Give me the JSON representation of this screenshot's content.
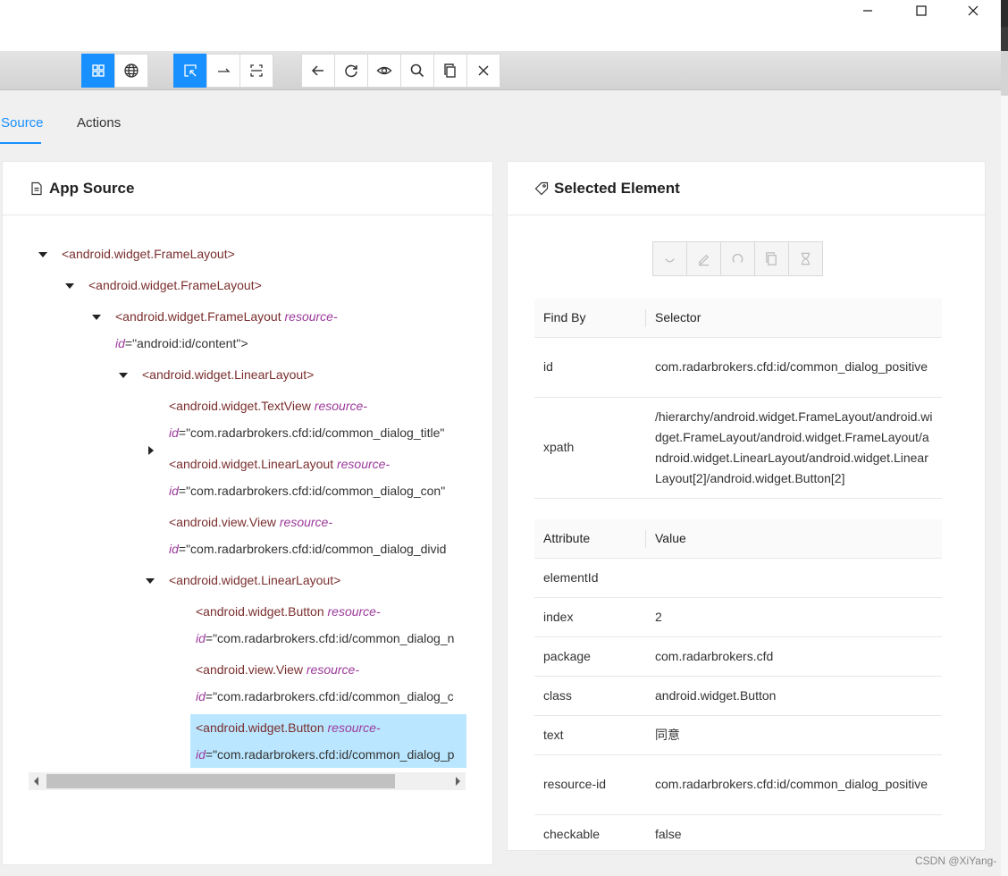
{
  "window": {
    "controls": [
      "minimize-icon",
      "maximize-icon",
      "close-icon"
    ]
  },
  "toolbar": {
    "group1": [
      {
        "icon": "grid-icon",
        "active": true
      },
      {
        "icon": "globe-icon",
        "active": false
      }
    ],
    "group2": [
      {
        "icon": "select-element-icon",
        "active": true
      },
      {
        "icon": "swipe-icon",
        "active": false
      },
      {
        "icon": "tap-coordinates-icon",
        "active": false
      }
    ],
    "group3": [
      {
        "icon": "back-icon"
      },
      {
        "icon": "refresh-icon"
      },
      {
        "icon": "eye-icon"
      },
      {
        "icon": "search-icon"
      },
      {
        "icon": "copy-icon"
      },
      {
        "icon": "close-session-icon"
      }
    ]
  },
  "tabs": {
    "source": "Source",
    "actions": "Actions"
  },
  "app_source": {
    "title": "App Source",
    "nodes": [
      {
        "tag": "<android.widget.FrameLayout>"
      },
      {
        "tag": "<android.widget.FrameLayout>"
      },
      {
        "tag": "<android.widget.FrameLayout",
        "attr": "resource-",
        "attr2": "id",
        "val": "=\"android:id/content\">"
      },
      {
        "tag": "<android.widget.LinearLayout>"
      },
      {
        "tag": "<android.widget.TextView",
        "attr": "resource-",
        "attr2": "id",
        "val": "=\"com.radarbrokers.cfd:id/common_dialog_title\""
      },
      {
        "tag": "<android.widget.LinearLayout",
        "attr": "resource-",
        "attr2": "id",
        "val": "=\"com.radarbrokers.cfd:id/common_dialog_con\""
      },
      {
        "tag": "<android.view.View",
        "attr": "resource-",
        "attr2": "id",
        "val": "=\"com.radarbrokers.cfd:id/common_dialog_divid"
      },
      {
        "tag": "<android.widget.LinearLayout>"
      },
      {
        "tag": "<android.widget.Button",
        "attr": "resource-",
        "attr2": "id",
        "val": "=\"com.radarbrokers.cfd:id/common_dialog_n"
      },
      {
        "tag": "<android.view.View",
        "attr": "resource-",
        "attr2": "id",
        "val": "=\"com.radarbrokers.cfd:id/common_dialog_c"
      },
      {
        "tag": "<android.widget.Button",
        "attr": "resource-",
        "attr2": "id",
        "val": "=\"com.radarbrokers.cfd:id/common_dialog_p"
      }
    ]
  },
  "selected_element": {
    "title": "Selected Element",
    "actions": [
      "tap-icon",
      "edit-icon",
      "clear-icon",
      "copy-icon",
      "timing-icon"
    ],
    "find_by": {
      "headers": [
        "Find By",
        "Selector"
      ],
      "rows": [
        [
          "id",
          "com.radarbrokers.cfd:id/common_dialog_positive"
        ],
        [
          "xpath",
          "/hierarchy/android.widget.FrameLayout/android.widget.FrameLayout/android.widget.FrameLayout/android.widget.LinearLayout/android.widget.LinearLayout[2]/android.widget.Button[2]"
        ]
      ]
    },
    "attributes": {
      "headers": [
        "Attribute",
        "Value"
      ],
      "rows": [
        [
          "elementId",
          ""
        ],
        [
          "index",
          "2"
        ],
        [
          "package",
          "com.radarbrokers.cfd"
        ],
        [
          "class",
          "android.widget.Button"
        ],
        [
          "text",
          "同意"
        ],
        [
          "resource-id",
          "com.radarbrokers.cfd:id/common_dialog_positive"
        ],
        [
          "checkable",
          "false"
        ]
      ]
    }
  },
  "watermark": "CSDN @XiYang-",
  "colors": {
    "accent": "#1890ff",
    "selected_row": "#bae7ff",
    "tag": "#7a2e2e",
    "attr": "#9b3a9b"
  }
}
